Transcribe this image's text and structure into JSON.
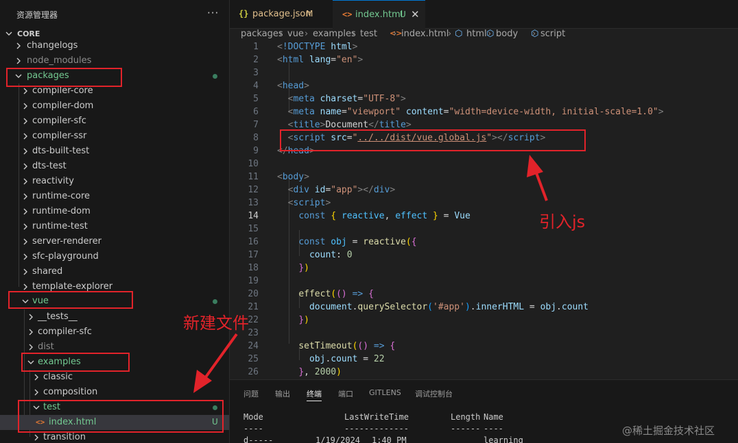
{
  "sidebar": {
    "title": "资源管理器",
    "more_glyph": "···",
    "section": "CORE",
    "items": [
      {
        "label": "changelogs",
        "name": "tree-item-changelogs"
      },
      {
        "label": "node_modules",
        "name": "tree-item-node-modules"
      },
      {
        "label": "packages",
        "name": "tree-item-packages"
      },
      {
        "label": "compiler-core",
        "name": "tree-item-compiler-core"
      },
      {
        "label": "compiler-dom",
        "name": "tree-item-compiler-dom"
      },
      {
        "label": "compiler-sfc",
        "name": "tree-item-compiler-sfc"
      },
      {
        "label": "compiler-ssr",
        "name": "tree-item-compiler-ssr"
      },
      {
        "label": "dts-built-test",
        "name": "tree-item-dts-built-test"
      },
      {
        "label": "dts-test",
        "name": "tree-item-dts-test"
      },
      {
        "label": "reactivity",
        "name": "tree-item-reactivity"
      },
      {
        "label": "runtime-core",
        "name": "tree-item-runtime-core"
      },
      {
        "label": "runtime-dom",
        "name": "tree-item-runtime-dom"
      },
      {
        "label": "runtime-test",
        "name": "tree-item-runtime-test"
      },
      {
        "label": "server-renderer",
        "name": "tree-item-server-renderer"
      },
      {
        "label": "sfc-playground",
        "name": "tree-item-sfc-playground"
      },
      {
        "label": "shared",
        "name": "tree-item-shared"
      },
      {
        "label": "template-explorer",
        "name": "tree-item-template-explorer"
      },
      {
        "label": "vue",
        "name": "tree-item-vue"
      },
      {
        "label": "__tests__",
        "name": "tree-item-tests"
      },
      {
        "label": "compiler-sfc",
        "name": "tree-item-vue-compiler-sfc"
      },
      {
        "label": "dist",
        "name": "tree-item-dist"
      },
      {
        "label": "examples",
        "name": "tree-item-examples"
      },
      {
        "label": "classic",
        "name": "tree-item-classic"
      },
      {
        "label": "composition",
        "name": "tree-item-composition"
      },
      {
        "label": "test",
        "name": "tree-item-test"
      },
      {
        "label": "index.html",
        "name": "tree-item-index-html",
        "badge": "U"
      },
      {
        "label": "transition",
        "name": "tree-item-transition"
      }
    ]
  },
  "tabs": [
    {
      "icon": "{}",
      "label": "package.json",
      "status": "M"
    },
    {
      "icon": "<>",
      "label": "index.html",
      "status": "U",
      "close": "✕"
    }
  ],
  "breadcrumb": [
    "packages",
    "vue",
    "examples",
    "test",
    "index.html",
    "html",
    "body",
    "script"
  ],
  "code": {
    "line_numbers": [
      "1",
      "2",
      "3",
      "4",
      "5",
      "6",
      "7",
      "8",
      "9",
      "10",
      "11",
      "12",
      "13",
      "14",
      "15",
      "16",
      "17",
      "18",
      "19",
      "20",
      "21",
      "22",
      "23",
      "24",
      "25",
      "26"
    ],
    "active_line": "14"
  },
  "panel": {
    "tabs": [
      "问题",
      "输出",
      "终端",
      "端口",
      "GITLENS",
      "调试控制台"
    ],
    "active_tab": "终端",
    "headers": {
      "mode": "Mode",
      "last_write": "LastWriteTime",
      "length": "Length",
      "name": "Name"
    },
    "dashes": {
      "mode": "----",
      "last_write": "-------------",
      "length": "------",
      "name": "----"
    },
    "row": {
      "mode": "d-----",
      "date": "1/19/2024",
      "time": "1:40 PM",
      "name": "learning"
    }
  },
  "annotations": {
    "new_file": "新建文件",
    "import_js": "引入js",
    "watermark": "@稀土掘金技术社区",
    "color": "#e2232a"
  },
  "colors": {
    "accent_blue": "#0078d4",
    "modified_orange": "#e2c08d",
    "untracked_green": "#73c991"
  }
}
